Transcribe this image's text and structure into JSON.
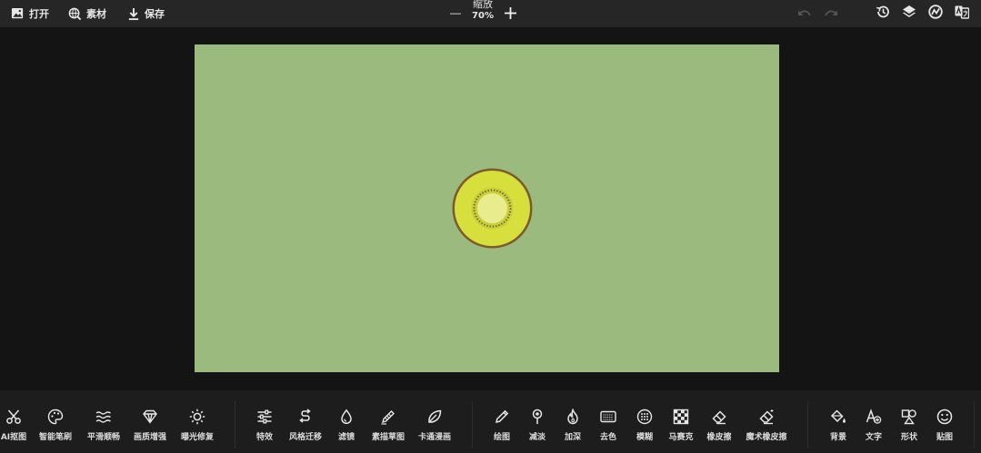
{
  "toolbar": {
    "open_label": "打开",
    "assets_label": "素材",
    "save_label": "保存",
    "zoom_title": "缩放",
    "zoom_value": "70%",
    "icons": [
      "image-icon",
      "globe-search-icon",
      "download-icon",
      "minus-icon",
      "plus-icon",
      "undo-icon",
      "redo-icon",
      "history-icon",
      "layers-icon",
      "filter-icon",
      "translate-icon"
    ]
  },
  "canvas": {
    "background_color": "#9abb7d",
    "sticker": "kiwi-slice"
  },
  "tools": {
    "ai_cutout": "AI抠图",
    "smart_brush": "智能笔刷",
    "smooth": "平滑顺畅",
    "enhance": "画质增强",
    "exposure_fix": "曝光修复",
    "effects": "特效",
    "style_transfer": "风格迁移",
    "filter": "滤镜",
    "sketch": "素描草图",
    "cartoon": "卡通漫画",
    "draw": "绘图",
    "lighten": "减淡",
    "darken": "加深",
    "desaturate": "去色",
    "blur": "模糊",
    "mosaic": "马赛克",
    "eraser": "橡皮擦",
    "magic_eraser": "魔术橡皮擦",
    "background": "背景",
    "text": "文字",
    "shape": "形状",
    "sticker": "贴图"
  }
}
